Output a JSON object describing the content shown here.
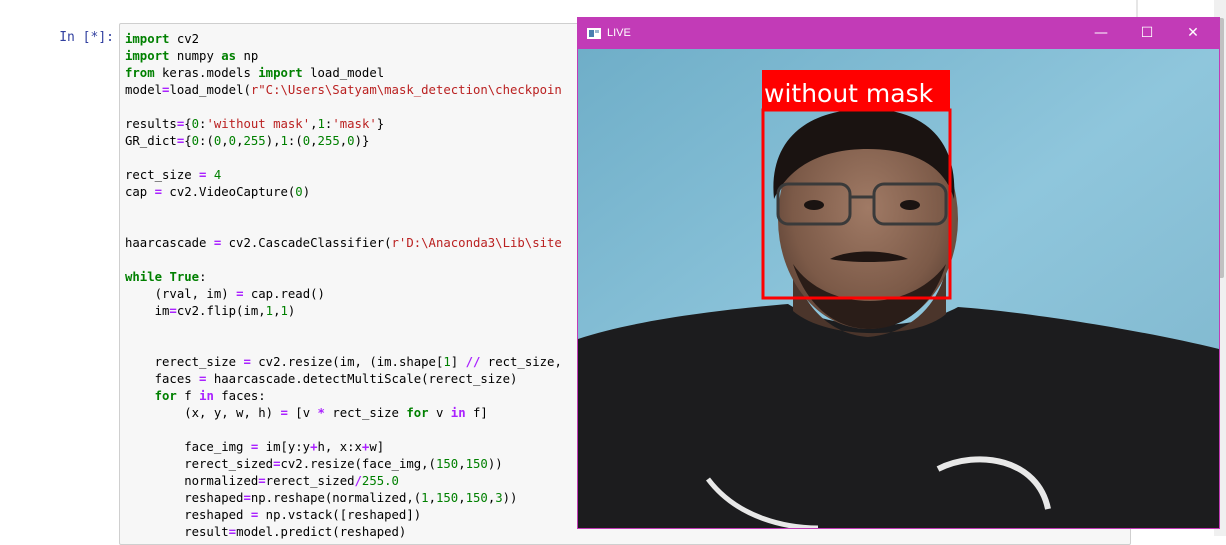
{
  "notebook": {
    "prompt": "In [*]:",
    "code_lines": [
      [
        {
          "t": "import",
          "c": "k"
        },
        {
          "t": " cv2"
        }
      ],
      [
        {
          "t": "import",
          "c": "k"
        },
        {
          "t": " numpy "
        },
        {
          "t": "as",
          "c": "k"
        },
        {
          "t": " np"
        }
      ],
      [
        {
          "t": "from",
          "c": "k"
        },
        {
          "t": " keras.models "
        },
        {
          "t": "import",
          "c": "k"
        },
        {
          "t": " load_model"
        }
      ],
      [
        {
          "t": "model"
        },
        {
          "t": "=",
          "c": "o"
        },
        {
          "t": "load_model("
        },
        {
          "t": "r\"C:\\Users\\Satyam\\mask_detection\\checkpoin",
          "c": "s"
        }
      ],
      [],
      [
        {
          "t": "results"
        },
        {
          "t": "=",
          "c": "o"
        },
        {
          "t": "{"
        },
        {
          "t": "0",
          "c": "n"
        },
        {
          "t": ":"
        },
        {
          "t": "'without mask'",
          "c": "s"
        },
        {
          "t": ","
        },
        {
          "t": "1",
          "c": "n"
        },
        {
          "t": ":"
        },
        {
          "t": "'mask'",
          "c": "s"
        },
        {
          "t": "}"
        }
      ],
      [
        {
          "t": "GR_dict"
        },
        {
          "t": "=",
          "c": "o"
        },
        {
          "t": "{"
        },
        {
          "t": "0",
          "c": "n"
        },
        {
          "t": ":("
        },
        {
          "t": "0",
          "c": "n"
        },
        {
          "t": ","
        },
        {
          "t": "0",
          "c": "n"
        },
        {
          "t": ","
        },
        {
          "t": "255",
          "c": "n"
        },
        {
          "t": "),"
        },
        {
          "t": "1",
          "c": "n"
        },
        {
          "t": ":("
        },
        {
          "t": "0",
          "c": "n"
        },
        {
          "t": ","
        },
        {
          "t": "255",
          "c": "n"
        },
        {
          "t": ","
        },
        {
          "t": "0",
          "c": "n"
        },
        {
          "t": ")}"
        }
      ],
      [],
      [
        {
          "t": "rect_size "
        },
        {
          "t": "=",
          "c": "o"
        },
        {
          "t": " "
        },
        {
          "t": "4",
          "c": "n"
        }
      ],
      [
        {
          "t": "cap "
        },
        {
          "t": "=",
          "c": "o"
        },
        {
          "t": " cv2.VideoCapture("
        },
        {
          "t": "0",
          "c": "n"
        },
        {
          "t": ")"
        }
      ],
      [],
      [],
      [
        {
          "t": "haarcascade "
        },
        {
          "t": "=",
          "c": "o"
        },
        {
          "t": " cv2.CascadeClassifier("
        },
        {
          "t": "r'D:\\Anaconda3\\Lib\\site",
          "c": "s"
        }
      ],
      [],
      [
        {
          "t": "while",
          "c": "k"
        },
        {
          "t": " "
        },
        {
          "t": "True",
          "c": "k"
        },
        {
          "t": ":"
        }
      ],
      [
        {
          "t": "    (rval, im) "
        },
        {
          "t": "=",
          "c": "o"
        },
        {
          "t": " cap.read()"
        }
      ],
      [
        {
          "t": "    im"
        },
        {
          "t": "=",
          "c": "o"
        },
        {
          "t": "cv2.flip(im,"
        },
        {
          "t": "1",
          "c": "n"
        },
        {
          "t": ","
        },
        {
          "t": "1",
          "c": "n"
        },
        {
          "t": ")"
        }
      ],
      [],
      [],
      [
        {
          "t": "    rerect_size "
        },
        {
          "t": "=",
          "c": "o"
        },
        {
          "t": " cv2.resize(im, (im.shape["
        },
        {
          "t": "1",
          "c": "n"
        },
        {
          "t": "] "
        },
        {
          "t": "//",
          "c": "o"
        },
        {
          "t": " rect_size,"
        }
      ],
      [
        {
          "t": "    faces "
        },
        {
          "t": "=",
          "c": "o"
        },
        {
          "t": " haarcascade.detectMultiScale(rerect_size)"
        }
      ],
      [
        {
          "t": "    "
        },
        {
          "t": "for",
          "c": "k"
        },
        {
          "t": " f "
        },
        {
          "t": "in",
          "c": "o"
        },
        {
          "t": " faces:"
        }
      ],
      [
        {
          "t": "        (x, y, w, h) "
        },
        {
          "t": "=",
          "c": "o"
        },
        {
          "t": " [v "
        },
        {
          "t": "*",
          "c": "o"
        },
        {
          "t": " rect_size "
        },
        {
          "t": "for",
          "c": "k"
        },
        {
          "t": " v "
        },
        {
          "t": "in",
          "c": "o"
        },
        {
          "t": " f]"
        }
      ],
      [],
      [
        {
          "t": "        face_img "
        },
        {
          "t": "=",
          "c": "o"
        },
        {
          "t": " im[y:y"
        },
        {
          "t": "+",
          "c": "o"
        },
        {
          "t": "h, x:x"
        },
        {
          "t": "+",
          "c": "o"
        },
        {
          "t": "w]"
        }
      ],
      [
        {
          "t": "        rerect_sized"
        },
        {
          "t": "=",
          "c": "o"
        },
        {
          "t": "cv2.resize(face_img,("
        },
        {
          "t": "150",
          "c": "n"
        },
        {
          "t": ","
        },
        {
          "t": "150",
          "c": "n"
        },
        {
          "t": "))"
        }
      ],
      [
        {
          "t": "        normalized"
        },
        {
          "t": "=",
          "c": "o"
        },
        {
          "t": "rerect_sized"
        },
        {
          "t": "/",
          "c": "o"
        },
        {
          "t": "255.0",
          "c": "n"
        }
      ],
      [
        {
          "t": "        reshaped"
        },
        {
          "t": "=",
          "c": "o"
        },
        {
          "t": "np.reshape(normalized,("
        },
        {
          "t": "1",
          "c": "n"
        },
        {
          "t": ","
        },
        {
          "t": "150",
          "c": "n"
        },
        {
          "t": ","
        },
        {
          "t": "150",
          "c": "n"
        },
        {
          "t": ","
        },
        {
          "t": "3",
          "c": "n"
        },
        {
          "t": "))"
        }
      ],
      [
        {
          "t": "        reshaped "
        },
        {
          "t": "=",
          "c": "o"
        },
        {
          "t": " np.vstack([reshaped])"
        }
      ],
      [
        {
          "t": "        result"
        },
        {
          "t": "=",
          "c": "o"
        },
        {
          "t": "model.predict(reshaped)"
        }
      ]
    ]
  },
  "window": {
    "title": "LIVE",
    "minimize_glyph": "—",
    "maximize_glyph": "☐",
    "close_glyph": "✕",
    "titlebar_color": "#c23bb7"
  },
  "detection": {
    "label": "without mask",
    "box_color": "#ff0000",
    "label_text_color": "#ffffff"
  }
}
